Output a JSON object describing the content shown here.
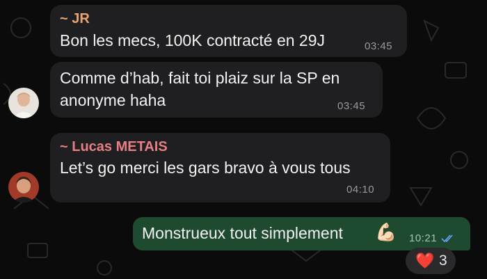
{
  "messages": [
    {
      "sender": "~ JR",
      "text": "Bon les mecs, 100K contracté en 29J",
      "time": "03:45"
    },
    {
      "text_line1": "Comme d’hab, fait toi plaiz sur la SP en",
      "text_line2": "anonyme haha",
      "time": "03:45"
    },
    {
      "sender": "~ Lucas METAIS",
      "text": "Let’s go merci les gars bravo à vous tous",
      "time": "04:10"
    }
  ],
  "outgoing": {
    "text": "Monstrueux tout simplement",
    "emoji": "💪🏻",
    "time": "10:21"
  },
  "reaction": {
    "emoji": "❤️",
    "count": "3"
  },
  "colors": {
    "background": "#0b0b0b",
    "incoming_bubble": "#1f1f21",
    "outgoing_bubble": "#1e4a2f",
    "sender_jr": "#e8a572",
    "sender_lucas": "#e77f84",
    "read_ticks": "#6aa8ff"
  },
  "icons": [
    "double-check-icon",
    "heart-icon",
    "avatar"
  ]
}
